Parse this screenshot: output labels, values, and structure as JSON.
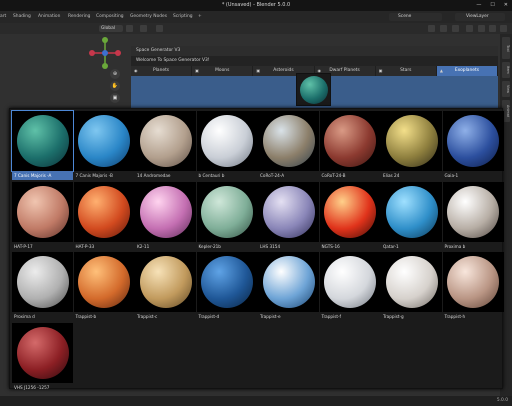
{
  "window": {
    "title": "* (Unsaved) - Blender 5.0.0",
    "buttons": [
      "—",
      "☐",
      "✕"
    ]
  },
  "menubar": {
    "tabs": [
      "art",
      "Shading",
      "Animation",
      "Rendering",
      "Compositing",
      "Geometry Nodes",
      "Scripting",
      "+"
    ],
    "scene": "Scene",
    "view_layer": "ViewLayer"
  },
  "viewport_header": {
    "orientation": "Global"
  },
  "side_tabs": [
    "Tool",
    "Item",
    "View",
    "Animat"
  ],
  "panel": {
    "title": "Space Generator V3",
    "welcome": "Welcome To Space Generator V3!",
    "tabs": [
      {
        "label": "Planets",
        "icon": "◉"
      },
      {
        "label": "Moons",
        "icon": "▣"
      },
      {
        "label": "Asteroids",
        "icon": "▣"
      },
      {
        "label": "Dwarf Planets",
        "icon": "◉"
      },
      {
        "label": "Stars",
        "icon": "▣"
      },
      {
        "label": "Exoplanets",
        "icon": "▲"
      }
    ],
    "active_tab": "Exoplanets"
  },
  "exoplanets": [
    {
      "name": "7 Canis Majoris -A",
      "c1": "#5fc1a8",
      "c2": "#1c6f6b",
      "c3": "#0b2e36"
    },
    {
      "name": "7 Canis Majoris -B",
      "c1": "#7fc7f0",
      "c2": "#2a86c7",
      "c3": "#0d3b6a"
    },
    {
      "name": "14 Andromedae",
      "c1": "#e6ddd2",
      "c2": "#b29f8d",
      "c3": "#5c4d44"
    },
    {
      "name": "b Centauri b",
      "c1": "#ffffff",
      "c2": "#c9ced6",
      "c3": "#6c7480"
    },
    {
      "name": "CoRoT-24-A",
      "c1": "#d9e2e8",
      "c2": "#8c7f6a",
      "c3": "#2f3f4c"
    },
    {
      "name": "CoRoT-24-B",
      "c1": "#d99a85",
      "c2": "#8c3a30",
      "c3": "#3a1410"
    },
    {
      "name": "Elias 24",
      "c1": "#f3df8a",
      "c2": "#8e7f3e",
      "c3": "#2e2a18"
    },
    {
      "name": "Gaia-1",
      "c1": "#8fb0e8",
      "c2": "#2c4f9e",
      "c3": "#0c1b45"
    },
    {
      "name": "HAT-P-17",
      "c1": "#f0c5b0",
      "c2": "#c07a66",
      "c3": "#5a2f28"
    },
    {
      "name": "HAT-P-33",
      "c1": "#ffb070",
      "c2": "#d24a1f",
      "c3": "#5c170b"
    },
    {
      "name": "K2-11",
      "c1": "#ffd4ef",
      "c2": "#c46fb2",
      "c3": "#5a2a55"
    },
    {
      "name": "Kepler-21b",
      "c1": "#cfe7d9",
      "c2": "#7fae98",
      "c3": "#2f4d40"
    },
    {
      "name": "LHS 3154",
      "c1": "#e4e0f2",
      "c2": "#8a86b8",
      "c3": "#2d2b55"
    },
    {
      "name": "NGTS-16",
      "c1": "#ffd08a",
      "c2": "#e0331b",
      "c3": "#3a0b06"
    },
    {
      "name": "Qatar-1",
      "c1": "#9fe0ff",
      "c2": "#2f8fc9",
      "c3": "#0b3552"
    },
    {
      "name": "Proxima b",
      "c1": "#ffffff",
      "c2": "#b7aea5",
      "c3": "#4b423d"
    },
    {
      "name": "Proxima d",
      "c1": "#ececec",
      "c2": "#b0b0b0",
      "c3": "#4a4a4a"
    },
    {
      "name": "Trappist-b",
      "c1": "#ffc07a",
      "c2": "#d36a2b",
      "c3": "#5a2510"
    },
    {
      "name": "Trappist-c",
      "c1": "#f7e2b8",
      "c2": "#c19a5d",
      "c3": "#5a4422"
    },
    {
      "name": "Trappist-d",
      "c1": "#5fa3e6",
      "c2": "#1f5797",
      "c3": "#0a2340"
    },
    {
      "name": "Trappist-e",
      "c1": "#ffffff",
      "c2": "#6ea4d6",
      "c3": "#17416e"
    },
    {
      "name": "Trappist-f",
      "c1": "#ffffff",
      "c2": "#d4d7dc",
      "c3": "#6d737c"
    },
    {
      "name": "Trappist-g",
      "c1": "#ffffff",
      "c2": "#d6d1cc",
      "c3": "#6e6862"
    },
    {
      "name": "Trappist-h",
      "c1": "#f8e6dc",
      "c2": "#b99584",
      "c3": "#5b4034"
    },
    {
      "name": "VHS J1256 -1257",
      "c1": "#d46a6a",
      "c2": "#8c1f24",
      "c3": "#2a0a0e"
    }
  ],
  "selected_index": 0,
  "status": {
    "version": "5.0.0"
  }
}
